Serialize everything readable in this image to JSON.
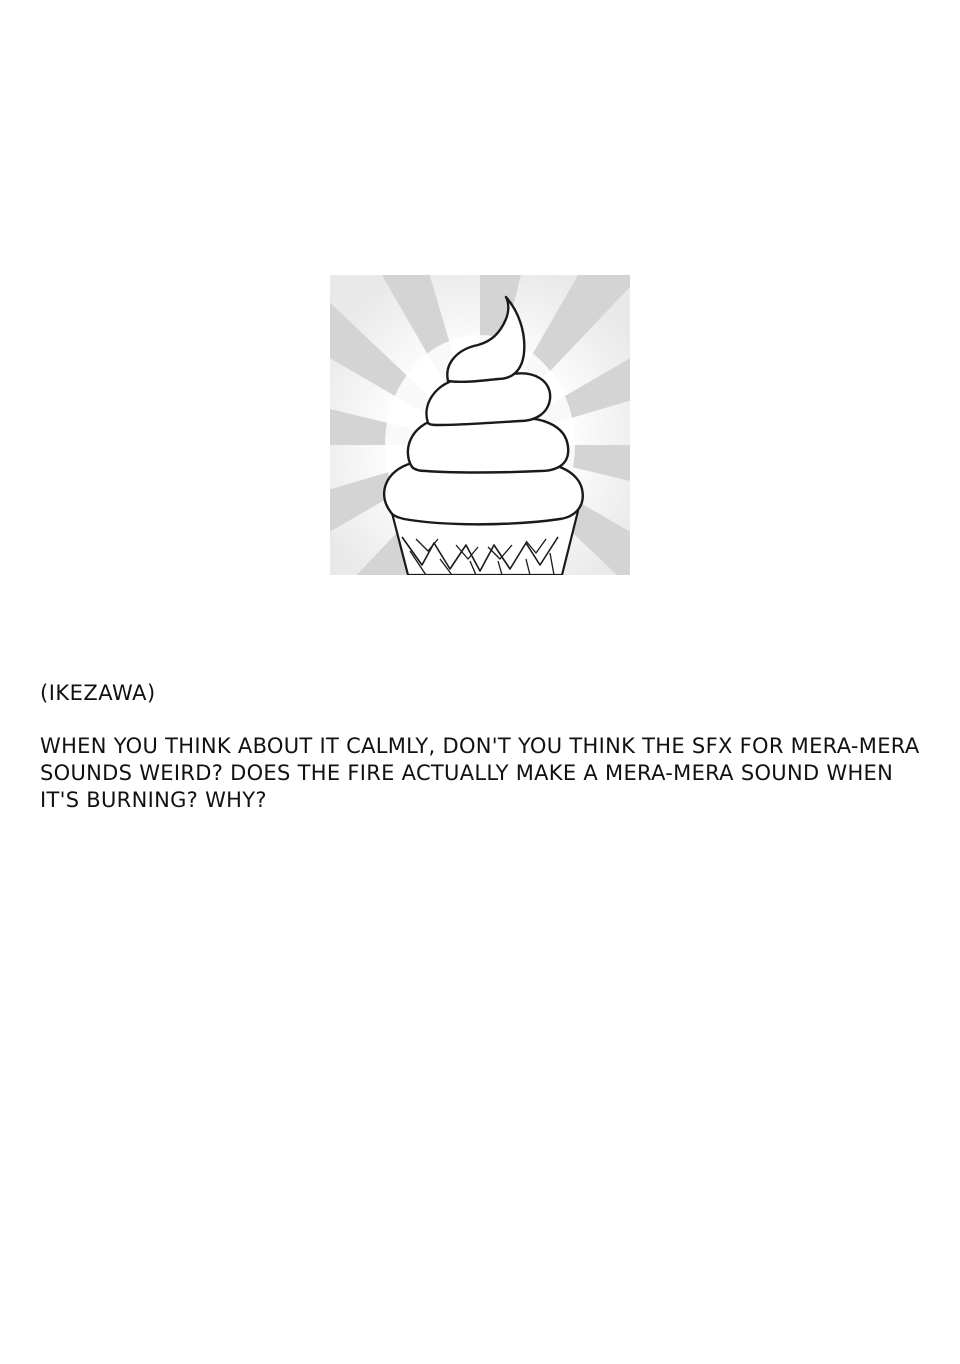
{
  "author": "(IKEZAWA)",
  "note_lines": [
    "WHEN YOU THINK ABOUT IT CALMLY, DON'T YOU THINK THE SFX FOR MERA-MERA",
    "SOUNDS WEIRD? DOES THE FIRE ACTUALLY MAKE A MERA-MERA SOUND WHEN",
    "IT'S BURNING? WHY?"
  ],
  "illustration": {
    "icon": "ice-cream-cone-icon",
    "ray_color": "#d4d4d4",
    "center_color": "#ffffff",
    "line_color": "#1a1a1a"
  }
}
